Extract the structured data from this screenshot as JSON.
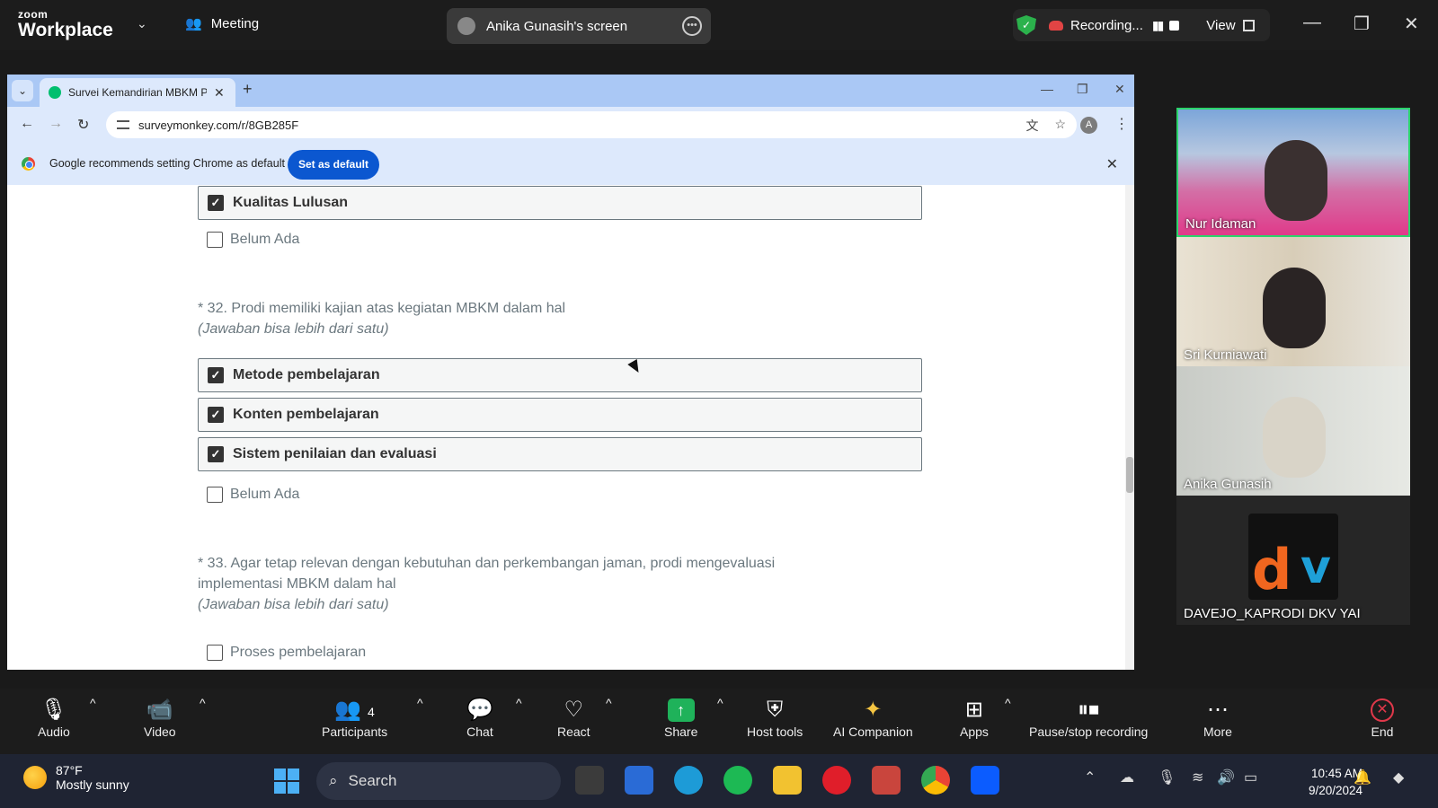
{
  "zoom": {
    "brand_top": "zoom",
    "brand_bottom": "Workplace",
    "meeting_label": "Meeting",
    "screen_share_label": "Anika Gunasih's screen",
    "recording_label": "Recording...",
    "view_label": "View"
  },
  "browser": {
    "tab_title": "Survei Kemandirian MBKM Prog",
    "url": "surveymonkey.com/r/8GB285F",
    "profile_initial": "A",
    "infobar_text": "Google recommends setting Chrome as default",
    "infobar_button": "Set as default"
  },
  "survey": {
    "q31_checked": "Kualitas Lulusan",
    "q31_unchecked": "Belum Ada",
    "q32_title": "* 32. Prodi memiliki kajian atas kegiatan MBKM dalam hal",
    "q32_hint": "(Jawaban bisa lebih dari satu)",
    "q32_options": [
      "Metode pembelajaran",
      "Konten pembelajaran",
      "Sistem penilaian dan evaluasi"
    ],
    "q32_unchecked": "Belum Ada",
    "q33_title_line1": "* 33. Agar tetap relevan dengan kebutuhan dan perkembangan jaman, prodi mengevaluasi",
    "q33_title_line2": "implementasi MBKM dalam hal",
    "q33_hint": "(Jawaban bisa lebih dari satu)",
    "q33_option1": "Proses pembelajaran"
  },
  "participants": [
    "Nur Idaman",
    "Sri Kurniawati",
    "Anika Gunasih",
    "DAVEJO_KAPRODI DKV YAI"
  ],
  "toolbar": {
    "audio": "Audio",
    "video": "Video",
    "participants": "Participants",
    "participants_count": "4",
    "chat": "Chat",
    "react": "React",
    "share": "Share",
    "host_tools": "Host tools",
    "ai_companion": "AI Companion",
    "apps": "Apps",
    "pause_stop": "Pause/stop recording",
    "more": "More",
    "end": "End"
  },
  "taskbar": {
    "temp": "87°F",
    "weather": "Mostly sunny",
    "search_placeholder": "Search",
    "time": "10:45 AM",
    "date": "9/20/2024"
  },
  "colors": {
    "share_green": "#1fb25a",
    "end_red": "#e0384a",
    "chrome_blue": "#0b57d0",
    "active_speaker": "#2bd46b"
  }
}
